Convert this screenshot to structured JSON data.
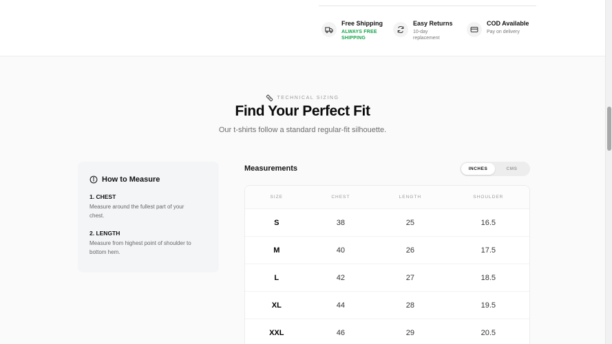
{
  "features": [
    {
      "icon": "truck-icon",
      "title": "Free Shipping",
      "subtitle_lines": [
        "ALWAYS FREE",
        "SHIPPING"
      ],
      "accent": "#16a34a"
    },
    {
      "icon": "refresh-icon",
      "title": "Easy Returns",
      "subtitle_lines": [
        "10-day",
        "replacement"
      ]
    },
    {
      "icon": "card-icon",
      "title": "COD Available",
      "subtitle_lines": [
        "Pay on delivery"
      ]
    }
  ],
  "section": {
    "eyebrow": "TECHNICAL SIZING",
    "eyebrow_icon": "ruler-icon",
    "title": "Find Your Perfect Fit",
    "subtitle": "Our t-shirts follow a standard regular-fit silhouette."
  },
  "how_to": {
    "icon": "info-icon",
    "title": "How to Measure",
    "steps": [
      {
        "title": "1. CHEST",
        "desc_lines": [
          "Measure around the fullest part of your",
          "chest."
        ]
      },
      {
        "title": "2. LENGTH",
        "desc_lines": [
          "Measure from highest point of shoulder to",
          "bottom hem."
        ]
      }
    ]
  },
  "measurements": {
    "title": "Measurements",
    "units": [
      "INCHES",
      "CMS"
    ],
    "active_unit": "INCHES",
    "columns": [
      "SIZE",
      "CHEST",
      "LENGTH",
      "SHOULDER"
    ],
    "rows": [
      [
        "S",
        "38",
        "25",
        "16.5"
      ],
      [
        "M",
        "40",
        "26",
        "17.5"
      ],
      [
        "L",
        "42",
        "27",
        "18.5"
      ],
      [
        "XL",
        "44",
        "28",
        "19.5"
      ],
      [
        "XXL",
        "46",
        "29",
        "20.5"
      ]
    ]
  }
}
